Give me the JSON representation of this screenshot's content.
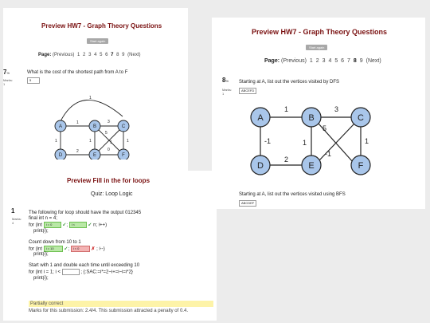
{
  "panel1": {
    "title": "Preview HW7 - Graph Theory Questions",
    "start_button": "Start again",
    "pager_label": "Page:",
    "pages": [
      "(Previous)",
      "1",
      "2",
      "3",
      "4",
      "5",
      "6",
      "7",
      "8",
      "9",
      "(Next)"
    ],
    "current_page": "7",
    "question_number": "7",
    "question_suffix": "%",
    "marks_label": "Marks:",
    "marks_value": "1",
    "question_text": "What is the cost of the shortest path from A to F",
    "answer_value": "5",
    "graph": {
      "nodes": [
        "A",
        "B",
        "C",
        "D",
        "E",
        "F"
      ],
      "edge_labels": [
        "1",
        "1",
        "3",
        "5",
        "1",
        "1",
        "2",
        "0",
        "1",
        "1"
      ]
    }
  },
  "panel2": {
    "title": "Preview HW7 - Graph Theory Questions",
    "start_button": "Start again",
    "pager_label": "Page:",
    "pages": [
      "(Previous)",
      "1",
      "2",
      "3",
      "4",
      "5",
      "6",
      "7",
      "8",
      "9",
      "(Next)"
    ],
    "current_page": "8",
    "question_number": "8",
    "question_suffix": "%",
    "marks_label": "Marks:",
    "marks_value": "1",
    "question1_text": "Starting at A, list out the vertices visited by DFS",
    "answer1_value": "ABCEFD",
    "question2_text": "Starting at A, list out the vertices visited using BFS",
    "answer2_value": "ABCDEF",
    "graph": {
      "nodes": [
        "A",
        "B",
        "C",
        "D",
        "E",
        "F"
      ],
      "edge_labels": [
        "1",
        "3",
        "5",
        "-1",
        "1",
        "-1",
        "1",
        "2"
      ]
    }
  },
  "panel3": {
    "title": "Preview Fill in the for loops",
    "quiz_title": "Quiz: Loop Logic",
    "question_number": "1",
    "marks_label": "Marks:",
    "marks_value": "4",
    "intro": "The following for loop should have the output 012345",
    "code_final": "final int n = 4;",
    "loop1_prefix": "for (int",
    "loop1_blank1": "i = 0",
    "loop1_blank2": "i <",
    "loop1_suffix": "n; i++)",
    "print1": "print(i);",
    "count_text": "Count down from 10 to 1",
    "loop2_prefix": "for (int",
    "loop2_blank1": "i = 10",
    "loop2_blank2": "i < 0",
    "loop2_suffix": "; i--)",
    "print2": "print(i);",
    "double_text": "Start with 1 and double each time until exceeding 10",
    "loop3_prefix": "for (int i = 1; i <",
    "loop3_suffix": "; {:SAC:=i*=2~i+=i~i=i*2}",
    "print3": "print(i);",
    "status": "Partially correct",
    "feedback": "Marks for this submission: 2.4/4. This submission attracted a penalty of 0.4."
  }
}
